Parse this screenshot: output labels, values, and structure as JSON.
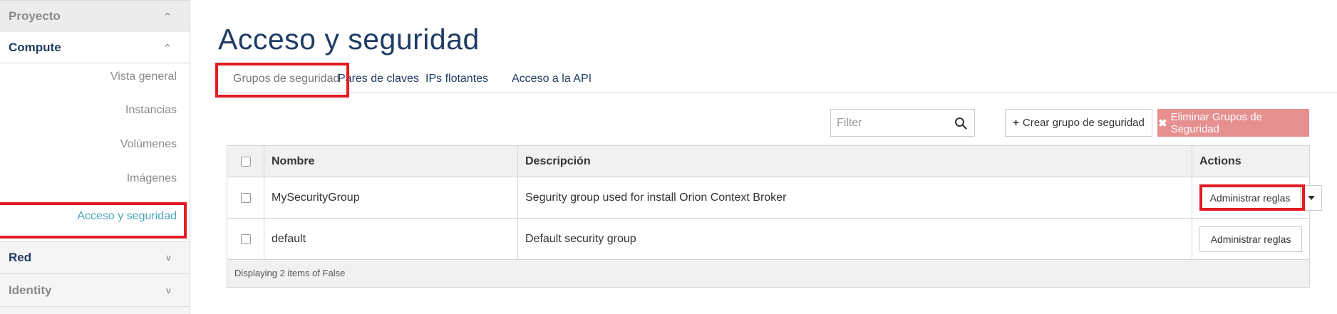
{
  "sidebar": {
    "project": {
      "label": "Proyecto",
      "icon": "chevron-up-icon"
    },
    "compute": {
      "label": "Compute",
      "icon": "chevron-up-icon"
    },
    "compute_items": [
      {
        "label": "Vista general"
      },
      {
        "label": "Instancias"
      },
      {
        "label": "Volúmenes"
      },
      {
        "label": "Imágenes"
      },
      {
        "label": "Acceso y seguridad",
        "active": true
      }
    ],
    "red": {
      "label": "Red",
      "icon": "chevron-down-icon"
    },
    "identity": {
      "label": "Identity",
      "icon": "chevron-down-icon"
    },
    "chevron_up": "^",
    "chevron_down": "v"
  },
  "page": {
    "title": "Acceso y seguridad"
  },
  "tabs": [
    {
      "label": "Grupos de seguridad",
      "active": true
    },
    {
      "label": "Pares de claves"
    },
    {
      "label": "IPs flotantes"
    },
    {
      "label": "Acceso a la API"
    }
  ],
  "toolbar": {
    "filter_placeholder": "Filter",
    "create_label": "Crear grupo de seguridad",
    "create_icon": "+",
    "delete_label": "Eliminar Grupos de Seguridad",
    "delete_icon": "✖"
  },
  "table": {
    "headers": {
      "name": "Nombre",
      "description": "Descripción",
      "actions": "Actions"
    },
    "rows": [
      {
        "name": "MySecurityGroup",
        "description": "Segurity group used for install Orion Context Broker",
        "action": "Administrar reglas"
      },
      {
        "name": "default",
        "description": "Default security group",
        "action": "Administrar reglas"
      }
    ],
    "footer": "Displaying 2 items of False"
  },
  "colors": {
    "brand_navy": "#1f3c64",
    "active_link": "#4aa6b8",
    "highlight_red": "#e31b23",
    "danger_button": "#e58f8f"
  }
}
